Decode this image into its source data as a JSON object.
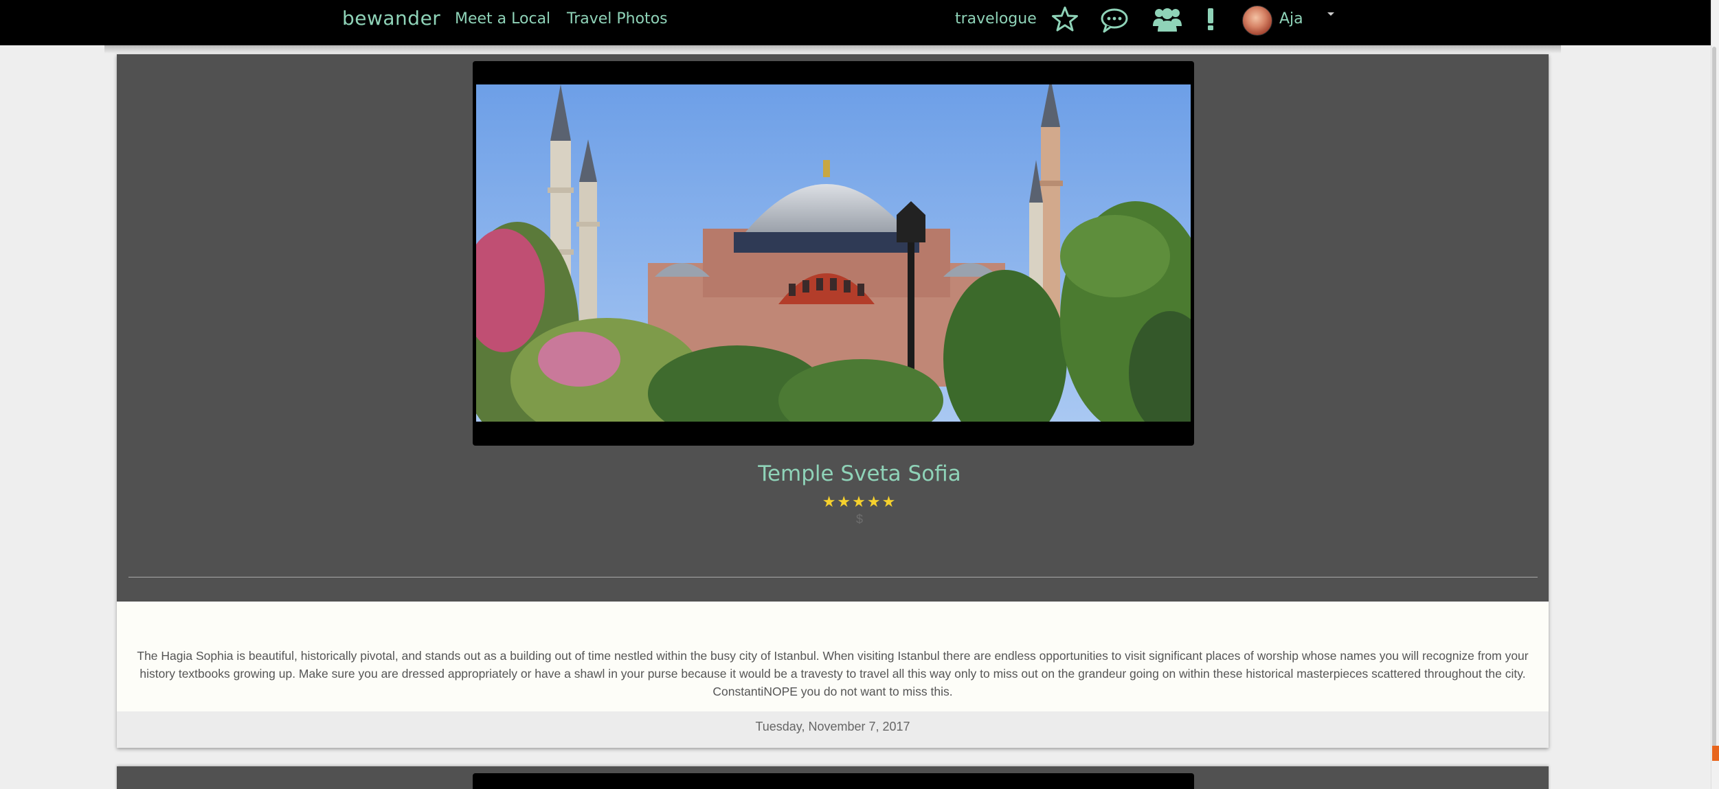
{
  "navbar": {
    "brand": "bewander",
    "links": [
      "Meet a Local",
      "Travel Photos"
    ],
    "travelogue": "travelogue",
    "icons": [
      "star-icon",
      "chat-icon",
      "users-icon",
      "alert-icon"
    ],
    "user_name": "Aja"
  },
  "post": {
    "title": "Temple Sveta Sofia",
    "rating": 5,
    "stars": "★★★★★",
    "price": "$",
    "description": "The Hagia Sophia is beautiful, historically pivotal, and stands out as a building out of time nestled within the busy city of Istanbul. When visiting Istanbul there are endless opportunities to visit significant places of worship whose names you will recognize from your history textbooks growing up. Make sure you are dressed appropriately or have a shawl in your purse because it would be a travesty to travel all this way only to miss out on the grandeur going on within these historical masterpieces scattered throughout the city. ConstantiNOPE you do not want to miss this.",
    "date": "Tuesday, November 7, 2017"
  },
  "colors": {
    "accent": "#8fd3b8",
    "star": "#f6d12d",
    "card": "#515151",
    "navbar": "#000000"
  }
}
